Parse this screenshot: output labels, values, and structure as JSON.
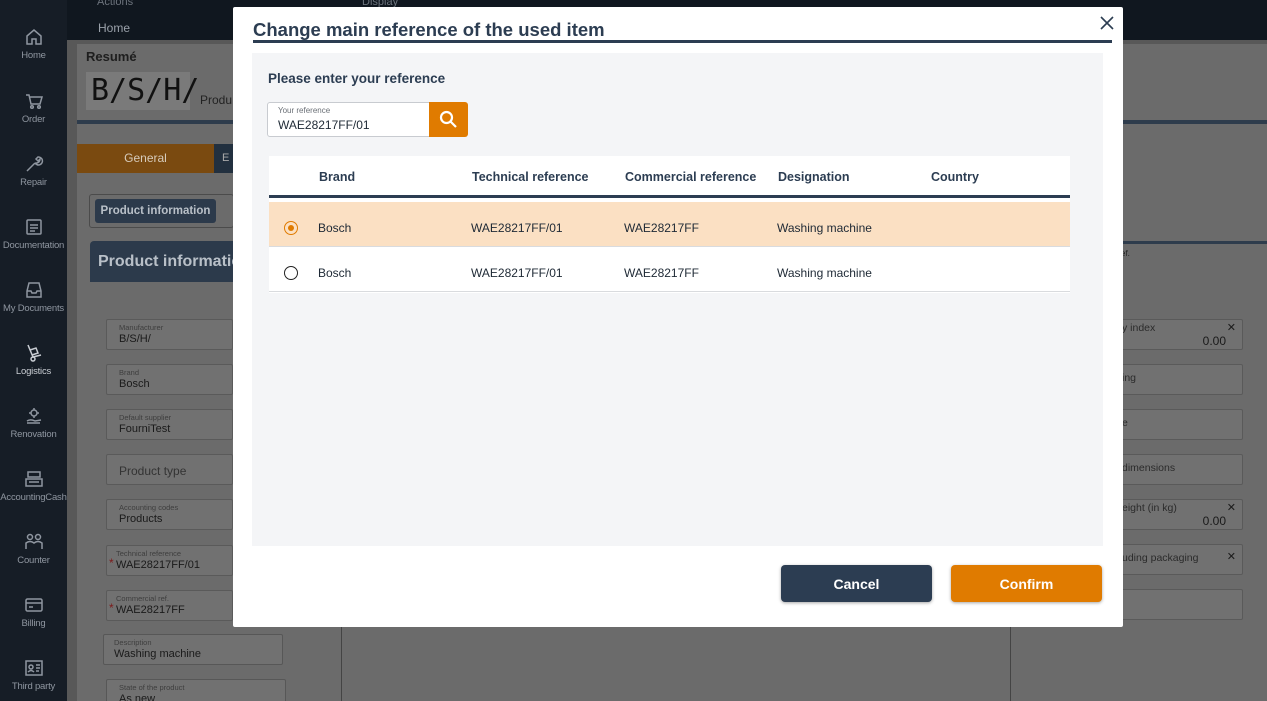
{
  "sidebar": {
    "items": [
      {
        "label": "Home",
        "icon": "home-icon"
      },
      {
        "label": "Order",
        "icon": "cart-icon"
      },
      {
        "label": "Repair",
        "icon": "wrench-icon"
      },
      {
        "label": "Documentation",
        "icon": "document-icon"
      },
      {
        "label": "My Documents",
        "icon": "inbox-icon"
      },
      {
        "label": "Logistics",
        "icon": "hand-truck-icon"
      },
      {
        "label": "Renovation",
        "icon": "gear-hand-icon"
      },
      {
        "label": "AccountingCash",
        "icon": "cash-register-icon"
      },
      {
        "label": "Counter",
        "icon": "people-icon"
      },
      {
        "label": "Billing",
        "icon": "credit-card-icon"
      },
      {
        "label": "Third party",
        "icon": "id-card-icon"
      }
    ]
  },
  "topbar": {
    "actions": "Actions",
    "display": "Display",
    "breadcrumb_home": "Home"
  },
  "background": {
    "resume_label": "Resumé",
    "logo_text": "B/S/H/",
    "product_text": "Produ",
    "tab_general": "General",
    "tab_e": "E",
    "chip_label": "Product information",
    "header_title": "Product information",
    "fields": [
      {
        "label": "Manufacturer",
        "value": "B/S/H/"
      },
      {
        "label": "Brand",
        "value": "Bosch"
      },
      {
        "label": "Default supplier",
        "value": "FourniTest"
      },
      {
        "label": "",
        "placeholder": "Product type"
      },
      {
        "label": "Accounting codes",
        "value": "Products"
      },
      {
        "label": "Technical reference",
        "value": "WAE28217FF/01"
      },
      {
        "label": "Commercial ref.",
        "value": "WAE28217FF"
      }
    ],
    "description": {
      "label": "Description",
      "value": "Washing machine"
    },
    "state": {
      "label": "State of the product",
      "value": "As new"
    },
    "right_ref_label": "ef.",
    "right_fields": [
      {
        "label": "y index",
        "value": "0.00"
      },
      {
        "label": "ing"
      },
      {
        "label": "e"
      },
      {
        "label": "dimensions"
      },
      {
        "label": "eight (in kg)",
        "value": "0.00"
      },
      {
        "label": "uding packaging"
      }
    ]
  },
  "modal": {
    "title": "Change main reference of the used item",
    "prompt": "Please enter your reference",
    "reference_label": "Your reference",
    "reference_value": "WAE28217FF/01",
    "columns": [
      "Brand",
      "Technical reference",
      "Commercial reference",
      "Designation",
      "Country"
    ],
    "rows": [
      {
        "brand": "Bosch",
        "technical": "WAE28217FF/01",
        "commercial": "WAE28217FF",
        "designation": "Washing machine",
        "country": "",
        "selected": true
      },
      {
        "brand": "Bosch",
        "technical": "WAE28217FF/01",
        "commercial": "WAE28217FF",
        "designation": "Washing machine",
        "country": "",
        "selected": false
      }
    ],
    "cancel_label": "Cancel",
    "confirm_label": "Confirm"
  },
  "colors": {
    "accent": "#e07b00",
    "primary": "#2c3d52",
    "selected_row": "#fbe0c3"
  }
}
